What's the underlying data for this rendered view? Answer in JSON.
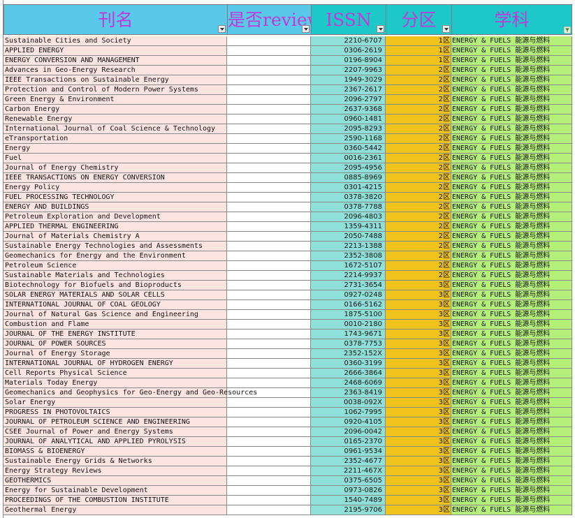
{
  "headers": {
    "name": "刊名",
    "review": "是否review",
    "issn": "ISSN",
    "zone": "分区",
    "subject": "学科"
  },
  "rows": [
    {
      "name": "Sustainable Cities and Society",
      "issn": "2210-6707",
      "zone": "1区",
      "subject": "ENERGY & FUELS 能源与燃料"
    },
    {
      "name": "APPLIED ENERGY",
      "issn": "0306-2619",
      "zone": "1区",
      "subject": "ENERGY & FUELS 能源与燃料"
    },
    {
      "name": "ENERGY CONVERSION AND MANAGEMENT",
      "issn": "0196-8904",
      "zone": "1区",
      "subject": "ENERGY & FUELS 能源与燃料"
    },
    {
      "name": "Advances in Geo-Energy Research",
      "issn": "2207-9963",
      "zone": "2区",
      "subject": "ENERGY & FUELS 能源与燃料"
    },
    {
      "name": "IEEE Transactions on Sustainable Energy",
      "issn": "1949-3029",
      "zone": "2区",
      "subject": "ENERGY & FUELS 能源与燃料"
    },
    {
      "name": "Protection and Control of Modern Power Systems",
      "issn": "2367-2617",
      "zone": "2区",
      "subject": "ENERGY & FUELS 能源与燃料"
    },
    {
      "name": "Green Energy & Environment",
      "issn": "2096-2797",
      "zone": "2区",
      "subject": "ENERGY & FUELS 能源与燃料"
    },
    {
      "name": "Carbon Energy",
      "issn": "2637-9368",
      "zone": "2区",
      "subject": "ENERGY & FUELS 能源与燃料"
    },
    {
      "name": "Renewable Energy",
      "issn": "0960-1481",
      "zone": "2区",
      "subject": "ENERGY & FUELS 能源与燃料"
    },
    {
      "name": "International Journal of Coal Science & Technology",
      "issn": "2095-8293",
      "zone": "2区",
      "subject": "ENERGY & FUELS 能源与燃料"
    },
    {
      "name": "eTransportation",
      "issn": "2590-1168",
      "zone": "2区",
      "subject": "ENERGY & FUELS 能源与燃料"
    },
    {
      "name": "Energy",
      "issn": "0360-5442",
      "zone": "2区",
      "subject": "ENERGY & FUELS 能源与燃料"
    },
    {
      "name": "Fuel",
      "issn": "0016-2361",
      "zone": "2区",
      "subject": "ENERGY & FUELS 能源与燃料"
    },
    {
      "name": "Journal of Energy Chemistry",
      "issn": "2095-4956",
      "zone": "2区",
      "subject": "ENERGY & FUELS 能源与燃料"
    },
    {
      "name": "IEEE TRANSACTIONS ON ENERGY CONVERSION",
      "issn": "0885-8969",
      "zone": "2区",
      "subject": "ENERGY & FUELS 能源与燃料"
    },
    {
      "name": "Energy Policy",
      "issn": "0301-4215",
      "zone": "2区",
      "subject": "ENERGY & FUELS 能源与燃料"
    },
    {
      "name": "FUEL PROCESSING TECHNOLOGY",
      "issn": "0378-3820",
      "zone": "2区",
      "subject": "ENERGY & FUELS 能源与燃料"
    },
    {
      "name": "ENERGY AND BUILDINGS",
      "issn": "0378-7788",
      "zone": "2区",
      "subject": "ENERGY & FUELS 能源与燃料"
    },
    {
      "name": "Petroleum Exploration and Development",
      "issn": "2096-4803",
      "zone": "2区",
      "subject": "ENERGY & FUELS 能源与燃料"
    },
    {
      "name": "APPLIED THERMAL ENGINEERING",
      "issn": "1359-4311",
      "zone": "2区",
      "subject": "ENERGY & FUELS 能源与燃料"
    },
    {
      "name": "Journal of Materials Chemistry A",
      "issn": "2050-7488",
      "zone": "2区",
      "subject": "ENERGY & FUELS 能源与燃料"
    },
    {
      "name": "Sustainable Energy Technologies and Assessments",
      "issn": "2213-1388",
      "zone": "2区",
      "subject": "ENERGY & FUELS 能源与燃料"
    },
    {
      "name": "Geomechanics for Energy and the Environment",
      "issn": "2352-3808",
      "zone": "2区",
      "subject": "ENERGY & FUELS 能源与燃料"
    },
    {
      "name": "Petroleum Science",
      "issn": "1672-5107",
      "zone": "2区",
      "subject": "ENERGY & FUELS 能源与燃料"
    },
    {
      "name": "Sustainable Materials and Technologies",
      "issn": "2214-9937",
      "zone": "2区",
      "subject": "ENERGY & FUELS 能源与燃料"
    },
    {
      "name": "Biotechnology for Biofuels and Bioproducts",
      "issn": "2731-3654",
      "zone": "3区",
      "subject": "ENERGY & FUELS 能源与燃料"
    },
    {
      "name": "SOLAR ENERGY MATERIALS AND SOLAR CELLS",
      "issn": "0927-0248",
      "zone": "3区",
      "subject": "ENERGY & FUELS 能源与燃料"
    },
    {
      "name": "INTERNATIONAL JOURNAL OF COAL GEOLOGY",
      "issn": "0166-5162",
      "zone": "3区",
      "subject": "ENERGY & FUELS 能源与燃料"
    },
    {
      "name": "Journal of Natural Gas Science and Engineering",
      "issn": "1875-5100",
      "zone": "3区",
      "subject": "ENERGY & FUELS 能源与燃料"
    },
    {
      "name": "Combustion and Flame",
      "issn": "0010-2180",
      "zone": "3区",
      "subject": "ENERGY & FUELS 能源与燃料"
    },
    {
      "name": "JOURNAL OF THE ENERGY INSTITUTE",
      "issn": "1743-9671",
      "zone": "3区",
      "subject": "ENERGY & FUELS 能源与燃料"
    },
    {
      "name": "JOURNAL OF POWER SOURCES",
      "issn": "0378-7753",
      "zone": "3区",
      "subject": "ENERGY & FUELS 能源与燃料"
    },
    {
      "name": "Journal of Energy Storage",
      "issn": "2352-152X",
      "zone": "3区",
      "subject": "ENERGY & FUELS 能源与燃料"
    },
    {
      "name": "INTERNATIONAL JOURNAL OF HYDROGEN ENERGY",
      "issn": "0360-3199",
      "zone": "3区",
      "subject": "ENERGY & FUELS 能源与燃料"
    },
    {
      "name": "Cell Reports Physical Science",
      "issn": "2666-3864",
      "zone": "3区",
      "subject": "ENERGY & FUELS 能源与燃料"
    },
    {
      "name": "Materials Today Energy",
      "issn": "2468-6069",
      "zone": "3区",
      "subject": "ENERGY & FUELS 能源与燃料"
    },
    {
      "name": "Geomechanics and Geophysics for Geo-Energy and Geo-Resources",
      "issn": "2363-8419",
      "zone": "3区",
      "subject": "ENERGY & FUELS 能源与燃料"
    },
    {
      "name": "Solar Energy",
      "issn": "0038-092X",
      "zone": "3区",
      "subject": "ENERGY & FUELS 能源与燃料"
    },
    {
      "name": "PROGRESS IN PHOTOVOLTAICS",
      "issn": "1062-7995",
      "zone": "3区",
      "subject": "ENERGY & FUELS 能源与燃料"
    },
    {
      "name": "JOURNAL OF PETROLEUM SCIENCE AND ENGINEERING",
      "issn": "0920-4105",
      "zone": "3区",
      "subject": "ENERGY & FUELS 能源与燃料"
    },
    {
      "name": "CSEE Journal of Power and Energy Systems",
      "issn": "2096-0042",
      "zone": "3区",
      "subject": "ENERGY & FUELS 能源与燃料"
    },
    {
      "name": "JOURNAL OF ANALYTICAL AND APPLIED PYROLYSIS",
      "issn": "0165-2370",
      "zone": "3区",
      "subject": "ENERGY & FUELS 能源与燃料"
    },
    {
      "name": "BIOMASS & BIOENERGY",
      "issn": "0961-9534",
      "zone": "3区",
      "subject": "ENERGY & FUELS 能源与燃料"
    },
    {
      "name": "Sustainable Energy Grids & Networks",
      "issn": "2352-4677",
      "zone": "3区",
      "subject": "ENERGY & FUELS 能源与燃料"
    },
    {
      "name": "Energy Strategy Reviews",
      "issn": "2211-467X",
      "zone": "3区",
      "subject": "ENERGY & FUELS 能源与燃料"
    },
    {
      "name": "GEOTHERMICS",
      "issn": "0375-6505",
      "zone": "3区",
      "subject": "ENERGY & FUELS 能源与燃料"
    },
    {
      "name": "Energy for Sustainable Development",
      "issn": "0973-0826",
      "zone": "3区",
      "subject": "ENERGY & FUELS 能源与燃料"
    },
    {
      "name": "PROCEEDINGS OF THE COMBUSTION INSTITUTE",
      "issn": "1540-7489",
      "zone": "3区",
      "subject": "ENERGY & FUELS 能源与燃料"
    },
    {
      "name": "Geothermal Energy",
      "issn": "2195-9706",
      "zone": "3区",
      "subject": "ENERGY & FUELS 能源与燃料"
    }
  ],
  "colors": {
    "name_bg": "#fce4e0",
    "issn_bg": "#8ee0d8",
    "zone_bg": "#f0c21c",
    "subject_bg": "#b4f07a",
    "header_text": "#c03ad8"
  },
  "icons": {
    "filter_dropdown": "chevron-down-icon",
    "filter_active": "funnel-icon"
  }
}
